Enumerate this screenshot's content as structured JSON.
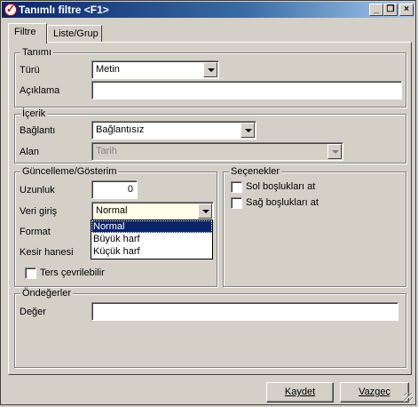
{
  "window": {
    "title": "Tanımlı filtre <F1>"
  },
  "title_buttons": {
    "minimize": "_",
    "restore": "❐",
    "close": "×"
  },
  "tabs": [
    {
      "label": "Filtre"
    },
    {
      "label": "Liste/Grup"
    }
  ],
  "tanimi": {
    "legend": "Tanımı",
    "turu_label": "Türü",
    "turu_value": "Metin",
    "aciklama_label": "Açıklama",
    "aciklama_value": ""
  },
  "icerik": {
    "legend": "İçerik",
    "baglanti_label": "Bağlantı",
    "baglanti_value": "Bağlantısız",
    "alan_label": "Alan",
    "alan_value": "Tarih"
  },
  "guncelleme": {
    "legend": "Güncelleme/Gösterim",
    "uzunluk_label": "Uzunluk",
    "uzunluk_value": "0",
    "veri_giris_label": "Veri giriş",
    "veri_giris_value": "Normal",
    "veri_giris_options": [
      "Normal",
      "Büyük harf",
      "Küçük harf"
    ],
    "format_label": "Format",
    "kesir_label": "Kesir hanesi",
    "ters_label": "Ters çevrilebilir"
  },
  "secenekler": {
    "legend": "Seçenekler",
    "sol_label": "Sol boşlukları at",
    "sag_label": "Sağ boşlukları at"
  },
  "ondegerler": {
    "legend": "Öndeğerler",
    "deger_label": "Değer",
    "deger_value": ""
  },
  "buttons": {
    "kaydet": "Kaydet",
    "vazgec": "Vazgeç"
  },
  "colors": {
    "titlebar_start": "#0a246a",
    "titlebar_end": "#a6caf0",
    "face": "#d4d0c8",
    "selection": "#0a246a"
  }
}
